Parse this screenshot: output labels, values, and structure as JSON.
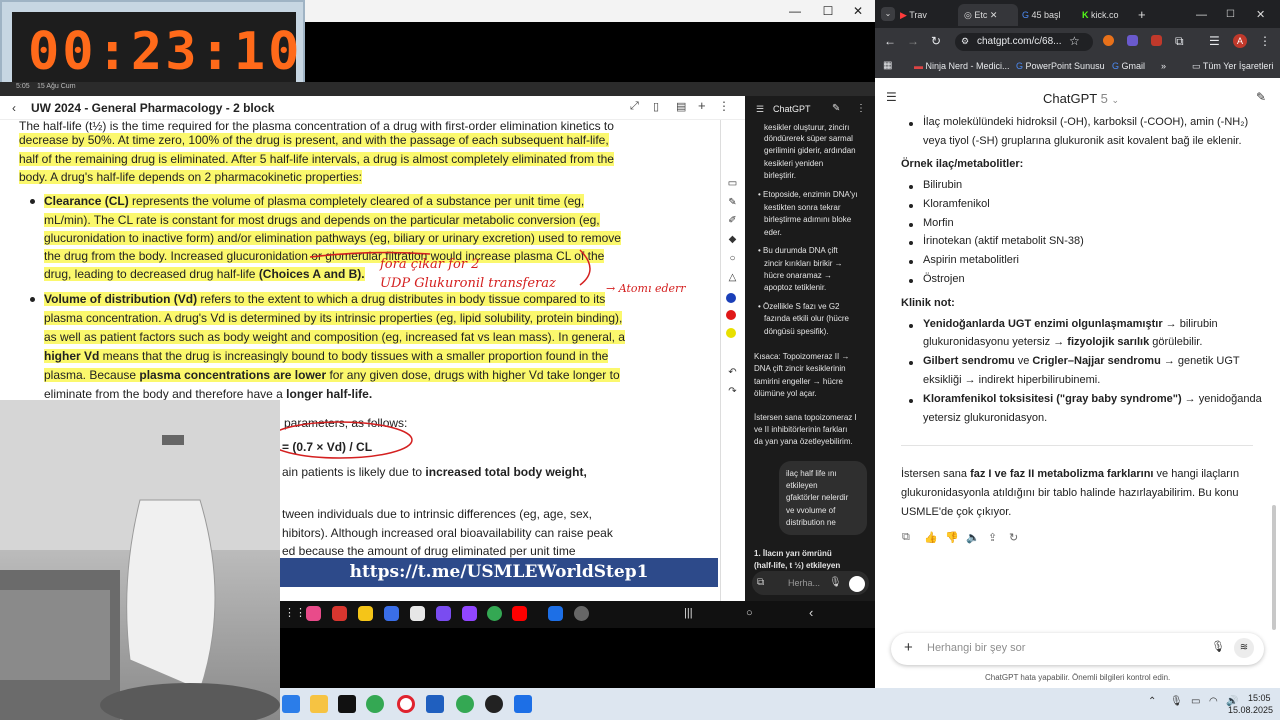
{
  "timer": {
    "value": "00:23:10",
    "time": "5:05",
    "date": "15 Ağu Cum"
  },
  "window_controls": {
    "minimize": "—",
    "maximize": "☐",
    "close": "✕"
  },
  "doc": {
    "title": "UW 2024 - General Pharmacology - 2 block",
    "lines": [
      "The half-life (t½) is the time required for the plasma concentration of a drug with first-order elimination kinetics to",
      "decrease by 50%.  At time zero, 100% of the drug is present, and with the passage of each subsequent half-life,",
      "half of the remaining drug is eliminated.  After 5 half-life intervals, a drug is almost completely eliminated from the",
      "body.  A drug's half-life depends on 2 pharmacokinetic properties:"
    ],
    "clearance": {
      "term": "Clearance (CL)",
      "lines": [
        " represents the volume of plasma completely cleared of a substance per unit time (eg,",
        "mL/min).  The CL rate is constant for most drugs and depends on the particular metabolic conversion (eg,",
        "glucuronidation to inactive form) and/or elimination pathways (eg, biliary or urinary excretion) used to remove",
        "the drug from the body.  Increased glucuronidation or glomerular filtration would increase plasma CL of the",
        "drug, leading to decreased drug half-life "
      ],
      "choices": "(Choices A and B)."
    },
    "vd": {
      "term": "Volume of distribution (Vd)",
      "lines": [
        " refers to the extent to which a drug distributes in body tissue compared to its",
        "plasma concentration.  A drug's Vd is determined by its intrinsic properties (eg, lipid solubility, protein binding),",
        "as well as patient factors such as body weight and composition (eg, increased fat vs lean mass).  In general, a",
        " means that the drug is increasingly bound to body tissues with a smaller proportion found in the",
        "plasma.  Because ",
        " for any given dose, drugs with higher Vd take longer to",
        "eliminate from the body and therefore have a "
      ],
      "higher_vd": "higher Vd",
      "plasma_lower": "plasma concentrations are lower",
      "longer": "longer half-life."
    },
    "lower_lines": [
      "parameters, as follows:",
      "= (0.7 × Vd) / CL",
      "ain patients is likely due to ",
      "increased total body weight,",
      "tween individuals due to intrinsic differences (eg, age, sex,",
      "hibitors).  Although increased oral bioavailability can raise peak",
      "ed because the amount of drug eliminated per unit time"
    ],
    "handwriting": [
      "fora çıkar  for 2",
      "UDP Glukuronil transferaz",
      "→ Atomı ederr"
    ],
    "watermark": "https://t.me/USMLEWorldStep1"
  },
  "mini_chat": {
    "title": "ChatGPT",
    "lines": [
      "kesikler oluşturur, zincirı",
      "döndürerek süper sarmal",
      "gerilimini giderir, ardından",
      "kesikleri yeniden",
      "birleştirir.",
      "• Etoposide, enzimin DNA'yı",
      "kestikten sonra tekrar",
      "birleştirme adımını bloke",
      "eder.",
      "• Bu durumda DNA çift",
      "zincir kırıkları birikir →",
      "hücre onaramaz →",
      "apoptoz tetiklenir.",
      "• Özellikle S fazı ve G2",
      "fazında etkili olur (hücre",
      "döngüsü spesifik).",
      "Kısaca: Topoizomeraz II →",
      "DNA çift zincir kesiklerinin",
      "tamirini engeller → hücre",
      "ölümüne yol açar.",
      "İstersen sana topoizomeraz I",
      "ve II inhibitörlerinin farkları",
      "da yan yana özetleyebilirim."
    ],
    "bubble": [
      "ilaç half life ını",
      "etkileyen",
      "gfaktörler nelerdir",
      "ve vvolume of",
      "distribution ne"
    ],
    "answer": [
      "1. İlacın yarı ömrünü",
      "(half-life, t ½) etkileyen"
    ],
    "input_placeholder": "Herha..."
  },
  "browser": {
    "tabs": [
      "Trav",
      "Etc",
      "45 başl",
      "kick.co"
    ],
    "url": "chatgpt.com/c/68...",
    "bookmarks": [
      "Ninja Nerd - Medici...",
      "PowerPoint Sunusu",
      "Gmail",
      "»",
      "Tüm Yer İşaretleri"
    ],
    "profile_initial": "A"
  },
  "chat": {
    "title": "ChatGPT",
    "version": "5",
    "intro": [
      "İlaç molekülündeki hidroksil (-OH), karboksil (-COOH), amin (-NH₂)",
      "veya tiyol (-SH) gruplarına glukuronik asit kovalent bağ ile eklenir."
    ],
    "examples_heading": "Örnek ilaç/metabolitler:",
    "examples": [
      "Bilirubin",
      "Kloramfenikol",
      "Morfin",
      "İrinotekan (aktif metabolit SN-38)",
      "Aspirin metabolitleri",
      "Östrojen"
    ],
    "clinical_heading": "Klinik not:",
    "clinical": [
      {
        "bold": "Yenidoğanlarda UGT enzimi olgunlaşmamıştır",
        "rest": " → bilirubin",
        "line2_pre": "glukuronidasyonu yetersiz → ",
        "line2_bold": "fizyolojik sarılık",
        "line2_post": " görülebilir."
      },
      {
        "bold": "Gilbert sendromu",
        "mid": " ve ",
        "bold2": "Crigler–Najjar sendromu",
        "rest": " → genetik UGT",
        "line2": "eksikliği → indirekt hiperbilirubinemi."
      },
      {
        "bold": "Kloramfenikol toksisitesi (\"gray baby syndrome\")",
        "rest": " → yenidoğanda",
        "line2": "yetersiz glukuronidasyon."
      }
    ],
    "closing": {
      "pre": "İstersen sana ",
      "bold": "faz I ve faz II metabolizma farklarını",
      "post": " ve hangi ilaçların",
      "line2": "glukuronidasyonla atıldığını bir tablo halinde hazırlayabilirim. Bu konu",
      "line3": "USMLE'de çok çıkıyor."
    },
    "input_placeholder": "Herhangi bir şey sor",
    "disclaimer": "ChatGPT hata yapabilir. Önemli bilgileri kontrol edin."
  },
  "taskbar": {
    "time": "15:05",
    "date": "15.08.2025"
  }
}
